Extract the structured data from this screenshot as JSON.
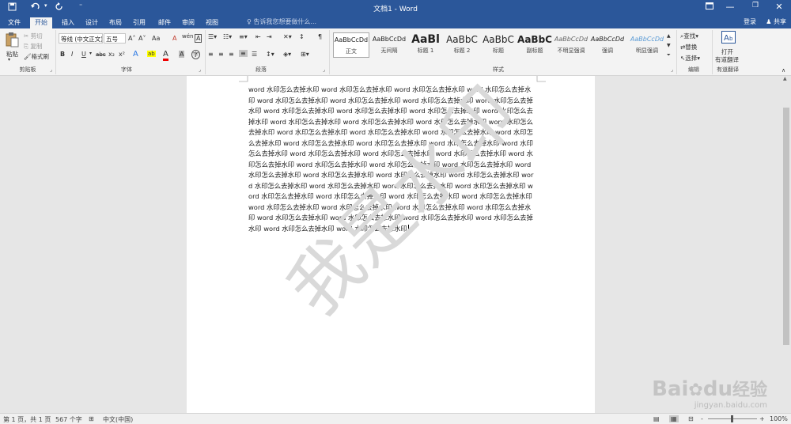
{
  "titlebar": {
    "title": "文档1 - Word",
    "save_icon": "save-icon",
    "undo_icon": "undo-icon",
    "redo_icon": "redo-icon",
    "customize": "⁼"
  },
  "tabs": [
    "文件",
    "开始",
    "插入",
    "设计",
    "布局",
    "引用",
    "邮件",
    "审阅",
    "视图"
  ],
  "tellme": "告诉我您想要做什么...",
  "account": {
    "login": "登录",
    "share": "共享"
  },
  "ribbon": {
    "clipboard": {
      "paste": "粘贴",
      "cut": "剪切",
      "copy": "复制",
      "format_painter": "格式刷",
      "label": "剪贴板"
    },
    "font": {
      "name": "等线 (中文正文)",
      "size": "五号",
      "grow": "A˄",
      "shrink": "A˅",
      "case": "Aa",
      "clear": "A",
      "wen": "wén",
      "A_box": "A",
      "bold": "B",
      "italic": "I",
      "underline": "U",
      "strike": "abc",
      "sub": "x₂",
      "sup": "x²",
      "effects": "A",
      "highlight": "ab",
      "color": "A",
      "shade": "A",
      "circle": "字",
      "label": "字体"
    },
    "paragraph": {
      "label": "段落"
    },
    "styles": {
      "items": [
        {
          "preview": "AaBbCcDd",
          "name": "正文"
        },
        {
          "preview": "AaBbCcDd",
          "name": "无间隔"
        },
        {
          "preview": "AaBl",
          "name": "标题 1"
        },
        {
          "preview": "AaBbC",
          "name": "标题 2"
        },
        {
          "preview": "AaBbC",
          "name": "标题"
        },
        {
          "preview": "AaBbC",
          "name": "副标题"
        },
        {
          "preview": "AaBbCcDd",
          "name": "不明显强调"
        },
        {
          "preview": "AaBbCcDd",
          "name": "强调"
        },
        {
          "preview": "AaBbCcDd",
          "name": "明显强调"
        }
      ],
      "label": "样式"
    },
    "editing": {
      "find": "查找",
      "replace": "替换",
      "select": "选择",
      "label": "编辑"
    },
    "youdao": {
      "open": "打开",
      "name": "有道翻译",
      "label": "有道翻译"
    }
  },
  "document": {
    "body": "word 水印怎么去掉水印 word 水印怎么去掉水印 word 水印怎么去掉水印 word 水印怎么去掉水印 word 水印怎么去掉水印 word 水印怎么去掉水印 word 水印怎么去掉水印 word 水印怎么去掉水印 word 水印怎么去掉水印 word 水印怎么去掉水印 word 水印怎么去掉水印 word 水印怎么去掉水印 word 水印怎么去掉水印 word 水印怎么去掉水印 word 水印怎么去掉水印 word 水印怎么去掉水印 word 水印怎么去掉水印 word 水印怎么去掉水印 word 水印怎么去掉水印 word 水印怎么去掉水印 word 水印怎么去掉水印 word 水印怎么去掉水印 word 水印怎么去掉水印 word 水印怎么去掉水印 word 水印怎么去掉水印 word 水印怎么去掉水印 word 水印怎么去掉水印 word 水印怎么去掉水印 word 水印怎么去掉水印 word 水印怎么去掉水印 word 水印怎么去掉水印 word 水印怎么去掉水印 word 水印怎么去掉水印 word 水印怎么去掉水印 word 水印怎么去掉水印 word 水印怎么去掉水印 word 水印怎么去掉水印 word 水印怎么去掉水印 word 水印怎么去掉水印 word 水印怎么去掉水印 word 水印怎么去掉水印 word 水印怎么去掉水印 word 水印怎么去掉水印 word 水印怎么去掉水印 word 水印怎么去掉水印 word 水印怎么去掉水印 word 水印怎么去掉水印 word 水印怎么去掉水印 word 水印怎么去掉水印 word 水印怎么去掉水印 word 水印怎么去掉水印 word 水印怎么去掉水印 word 水印怎么去掉水印",
    "watermark": "我是水印"
  },
  "status": {
    "page": "第 1 页，共 1 页",
    "words": "567 个字",
    "lang": "中文(中国)",
    "zoom": "100%",
    "zoom_minus": "-",
    "zoom_plus": "+"
  },
  "overlay_logo": {
    "baidu": "Bai",
    "du": "du",
    "jingyan": "经验",
    "url": "jingyan.baidu.com"
  },
  "colors": {
    "brand": "#2b579a",
    "ribbon": "#f3f3f3",
    "page": "#ffffff",
    "canvas": "#e6e6e6"
  }
}
